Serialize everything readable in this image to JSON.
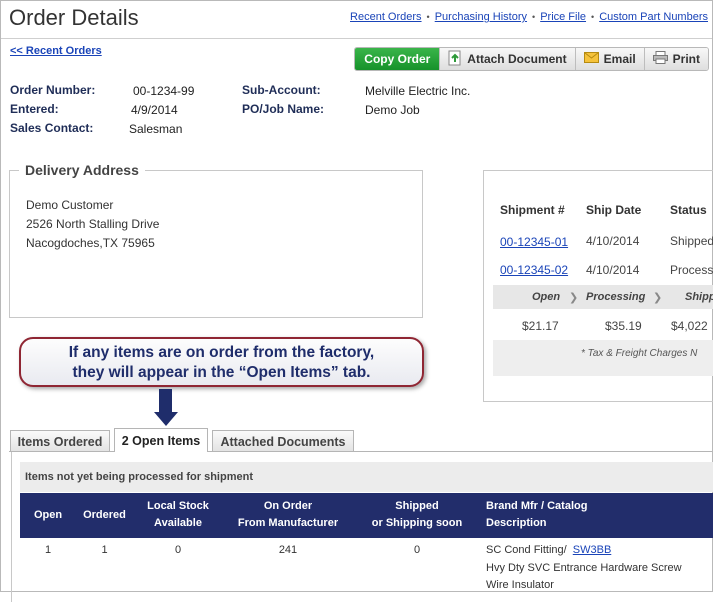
{
  "page": {
    "title": "Order Details"
  },
  "top_links": [
    "Recent Orders",
    "Purchasing History",
    "Price File",
    "Custom Part Numbers"
  ],
  "back_link": "<< Recent Orders",
  "toolbar": {
    "copy": "Copy Order",
    "attach": "Attach Document",
    "email": "Email",
    "print": "Print"
  },
  "order": {
    "number_label": "Order Number:",
    "number": "00-1234-99",
    "entered_label": "Entered:",
    "entered": "4/9/2014",
    "contact_label": "Sales Contact:",
    "contact": "Salesman",
    "subaccount_label": "Sub-Account:",
    "subaccount": "Melville Electric Inc.",
    "po_label": "PO/Job Name:",
    "po": "Demo Job"
  },
  "delivery": {
    "title": "Delivery Address",
    "lines": [
      "Demo Customer",
      "2526 North Stalling Drive",
      "Nacogdoches,TX 75965"
    ]
  },
  "shipments": {
    "headers": [
      "Shipment #",
      "Ship Date",
      "Status"
    ],
    "rows": [
      {
        "id": "00-12345-01",
        "date": "4/10/2014",
        "status": "Shipped"
      },
      {
        "id": "00-12345-02",
        "date": "4/10/2014",
        "status": "Process"
      }
    ],
    "stages": [
      "Open",
      "Processing",
      "Shipp"
    ],
    "amounts": [
      "$21.17",
      "$35.19",
      "$4,022"
    ],
    "note": "* Tax & Freight Charges N"
  },
  "callout": {
    "line1": "If any items are on order from the factory,",
    "line2": "they will appear in the “Open Items” tab."
  },
  "tabs": [
    "Items Ordered",
    "2 Open Items",
    "Attached Documents"
  ],
  "open_items": {
    "caption": "Items not yet being processed for shipment",
    "columns": {
      "open": "Open",
      "ordered": "Ordered",
      "local_1": "Local Stock",
      "local_2": "Available",
      "onorder_1": "On Order",
      "onorder_2": "From Manufacturer",
      "shipped_1": "Shipped",
      "shipped_2": "or Shipping soon",
      "brand_1": "Brand Mfr / Catalog",
      "brand_2": "Description"
    },
    "row": {
      "open": "1",
      "ordered": "1",
      "local": "0",
      "onorder": "241",
      "shipped": "0",
      "brand": "SC Cond Fitting/",
      "catalog": "SW3BB",
      "desc1": "Hvy Dty SVC Entrance Hardware Screw",
      "desc2": "Wire Insulator"
    }
  },
  "colors": {
    "link": "#1a44b8",
    "copy_button": "#16922a",
    "table_header": "#222d6b",
    "callout_border": "#8f2633"
  }
}
